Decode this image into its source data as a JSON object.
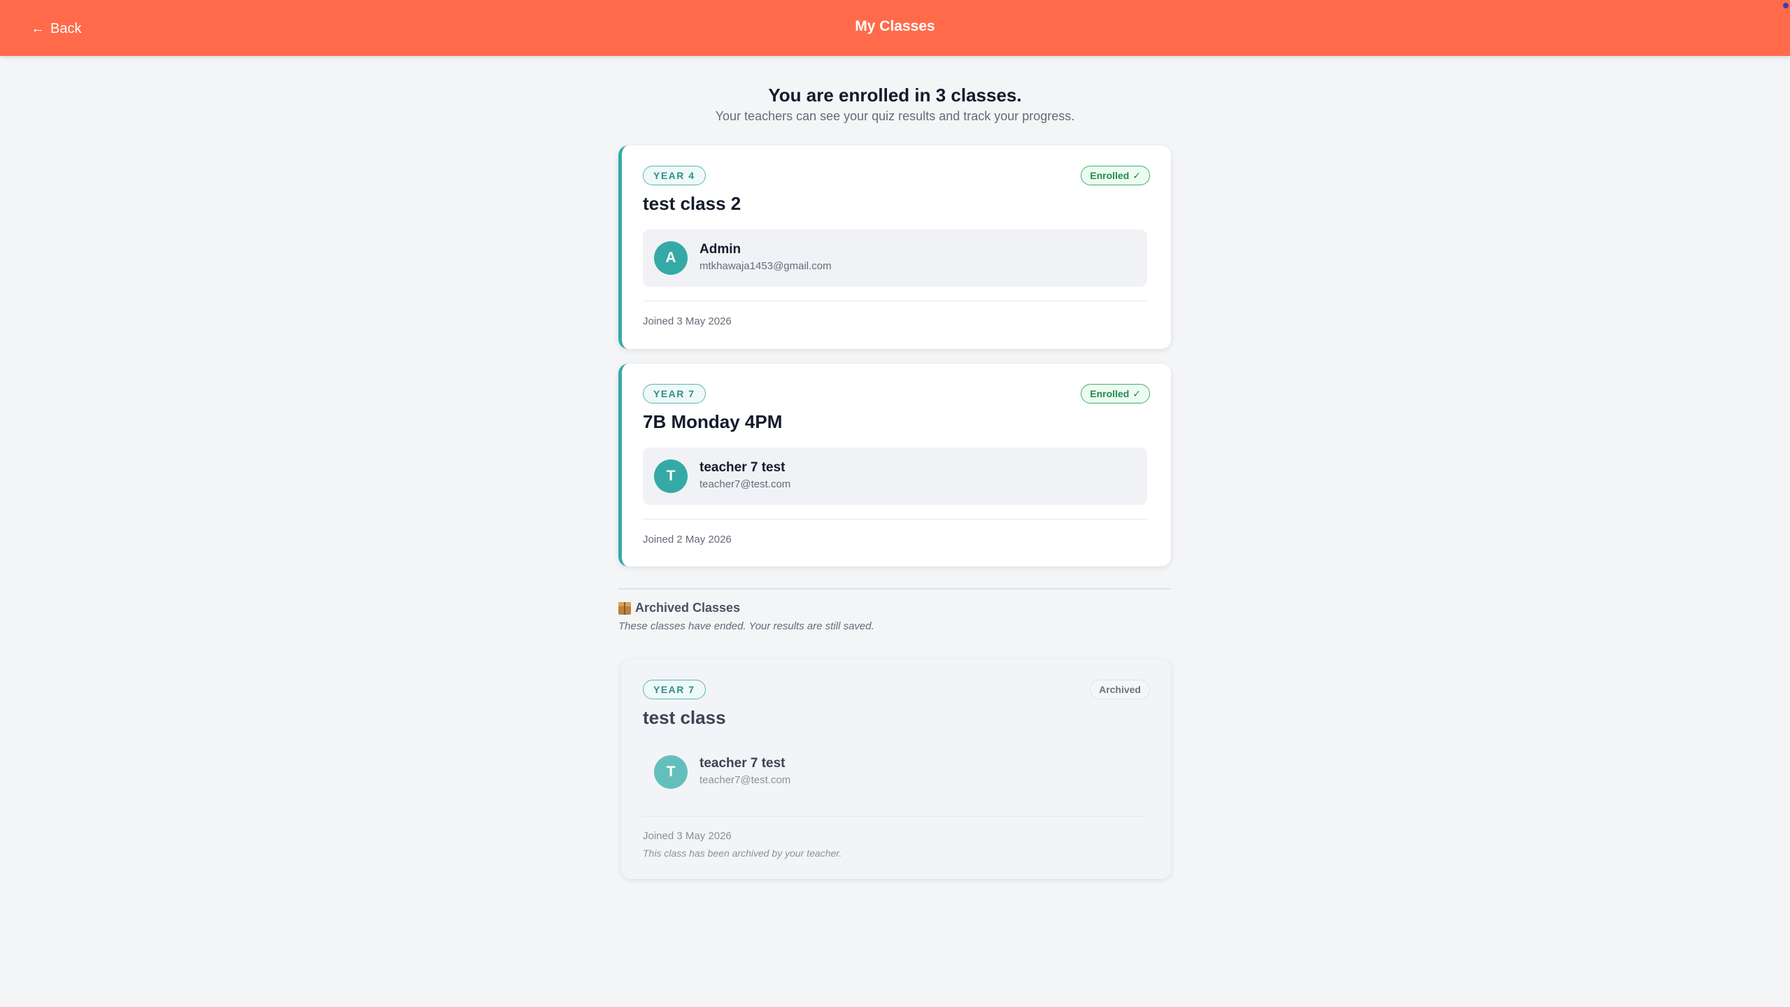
{
  "header": {
    "back_label": "Back",
    "title": "My Classes"
  },
  "summary": {
    "title": "You are enrolled in 3 classes.",
    "subtitle": "Your teachers can see your quiz results and track your progress."
  },
  "classes": [
    {
      "year": "YEAR 4",
      "status": "Enrolled",
      "name": "test class 2",
      "teacher": {
        "initial": "A",
        "name": "Admin",
        "email": "mtkhawaja1453@gmail.com"
      },
      "joined": "Joined 3 May 2026"
    },
    {
      "year": "YEAR 7",
      "status": "Enrolled",
      "name": "7B Monday 4PM",
      "teacher": {
        "initial": "T",
        "name": "teacher 7 test",
        "email": "teacher7@test.com"
      },
      "joined": "Joined 2 May 2026"
    }
  ],
  "archived": {
    "heading": "Archived Classes",
    "subtitle": "These classes have ended. Your results are still saved.",
    "classes": [
      {
        "year": "YEAR 7",
        "status": "Archived",
        "name": "test class",
        "teacher": {
          "initial": "T",
          "name": "teacher 7 test",
          "email": "teacher7@test.com"
        },
        "joined": "Joined 3 May 2026",
        "note": "This class has been archived by your teacher."
      }
    ]
  },
  "colors": {
    "header": "#ff6b4a",
    "accent": "#37aaa8",
    "enrolled": "#1f8c4c"
  }
}
